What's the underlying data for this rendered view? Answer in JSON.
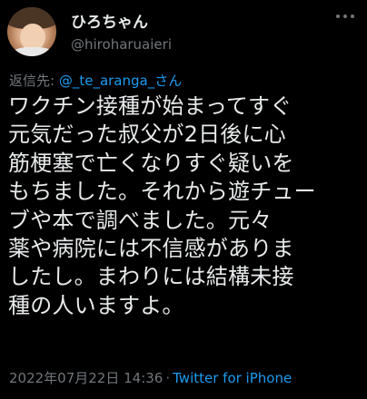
{
  "user": {
    "display_name": "ひろちゃん",
    "handle": "@hiroharuaieri"
  },
  "reply": {
    "prefix": "返信先: ",
    "mention": "@_te_aranga_さん"
  },
  "tweet": {
    "lines": [
      "ワクチン接種が始まってすぐ",
      "元気だった叔父が2日後に心",
      "筋梗塞で亡くなりすぐ疑いを",
      "もちました。それから遊チュー",
      "ブや本で調べました。元々",
      "薬や病院には不信感がありま",
      "したし。まわりには結構未接",
      "種の人いますよ。"
    ]
  },
  "meta": {
    "timestamp": "2022年07月22日 14:36",
    "separator": "·",
    "source": "Twitter for iPhone"
  },
  "icons": [
    "avatar",
    "more-icon"
  ],
  "colors": {
    "background": "#000000",
    "text": "#e7e9ea",
    "secondary": "#71767b",
    "accent": "#1d9bf0"
  }
}
